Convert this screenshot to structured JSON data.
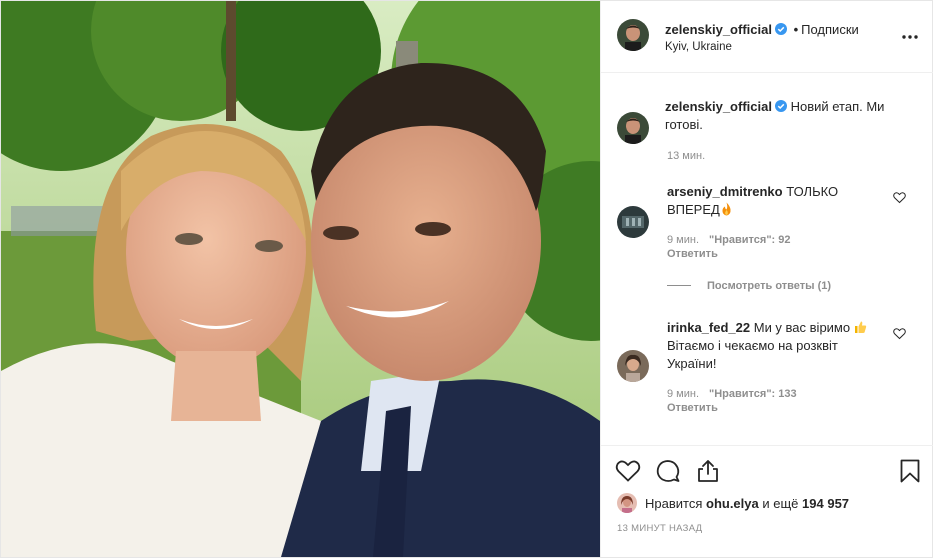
{
  "post": {
    "photo_alt": "selfie",
    "header": {
      "username": "zelenskiy_official",
      "separator": "•",
      "follow_label": "Подписки",
      "location": "Kyiv, Ukraine",
      "more_icon": "more-horizontal-icon"
    },
    "caption": {
      "username": "zelenskiy_official",
      "text": "Новий етап. Ми готові.",
      "time": "13 мин."
    },
    "comments": [
      {
        "username": "arseniy_dmitrenko",
        "text": "ТОЛЬКО ВПЕРЕД",
        "emoji": "fire-emoji",
        "time": "9 мин.",
        "likes": "\"Нравится\": 92",
        "reply": "Ответить"
      },
      {
        "username": "irinka_fed_22",
        "text_before": "Ми у вас віримо",
        "emoji": "thumbs-up-emoji",
        "text_after": "Вітаємо і чекаємо на розквіт України!",
        "time": "9 мин.",
        "likes": "\"Нравится\": 133",
        "reply": "Ответить"
      }
    ],
    "view_replies": "Посмотреть ответы (1)",
    "likes": {
      "prefix": "Нравится",
      "user": "ohu.elya",
      "connector": "и ещё",
      "count": "194 957"
    },
    "posted_ago": "13 МИНУТ НАЗАД",
    "colors": {
      "text": "#262626",
      "muted": "#8e8e8e",
      "verified": "#3897f0",
      "border": "#efefef"
    }
  }
}
